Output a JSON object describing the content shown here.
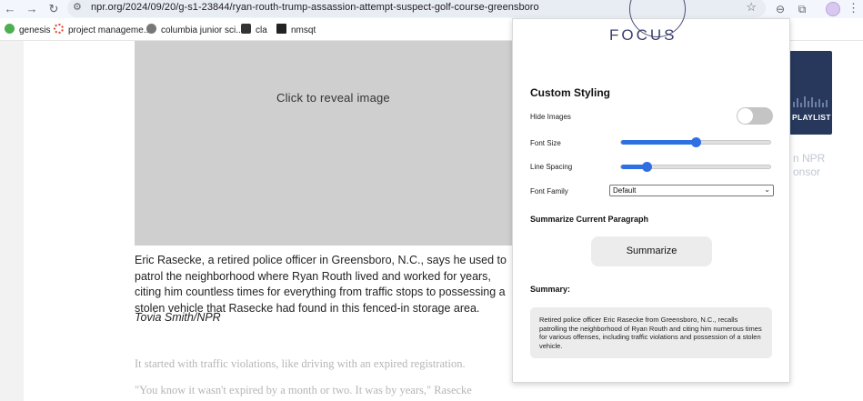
{
  "browser": {
    "url": "npr.org/2024/09/20/g-s1-23844/ryan-routh-trump-assassion-attempt-suspect-golf-course-greensboro",
    "bookmarks": [
      "genesis",
      "project manageme...",
      "columbia junior sci...",
      "cla",
      "nmsqt"
    ]
  },
  "page": {
    "image_placeholder": "Click to reveal image",
    "caption": "Eric Rasecke, a retired police officer in Greensboro, N.C., says he used to patrol the neighborhood where Ryan Routh lived and worked for years, citing him countless times for everything from traffic stops to possessing a stolen vehicle that Rasecke had found in this fenced-in storage area.",
    "caption_credit": "Tovia Smith/NPR",
    "body_line_1": "It started with traffic violations, like driving with an expired registration.",
    "body_line_2": "\"You know it wasn't expired by a month or two. It was by years,\" Rasecke",
    "side_card_label": "PLAYLIST",
    "side_text_1": "n NPR",
    "side_text_2": "onsor"
  },
  "extension": {
    "logo": "FOCUS",
    "section_title": "Custom Styling",
    "controls": {
      "hide_images_label": "Hide Images",
      "hide_images_on": false,
      "font_size_label": "Font Size",
      "font_size_value": 0.5,
      "line_spacing_label": "Line Spacing",
      "line_spacing_value": 0.17,
      "font_family_label": "Font Family",
      "font_family_value": "Default"
    },
    "summarize_title": "Summarize Current Paragraph",
    "summarize_button": "Summarize",
    "summary_label": "Summary:",
    "summary_text": "Retired police officer Eric Rasecke from Greensboro, N.C., recalls patrolling the neighborhood of Ryan Routh and citing him numerous times for various offenses, including traffic violations and possession of a stolen vehicle.",
    "accent_color": "#2f6fe4"
  }
}
